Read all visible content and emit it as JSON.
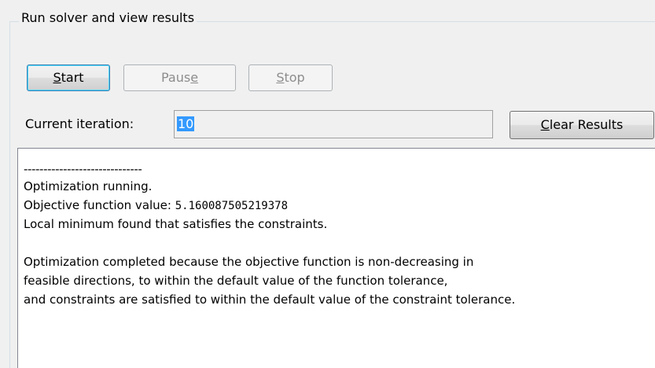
{
  "panel": {
    "title": "Run solver and view results"
  },
  "buttons": {
    "start": {
      "mnemonic": "S",
      "rest": "tart",
      "enabled": true
    },
    "pause": {
      "before": "Pau",
      "mnemonic": "s",
      "mnemonic2": "e",
      "enabled": false
    },
    "stop": {
      "mnemonic": "S",
      "rest": "top",
      "enabled": false
    },
    "clear": {
      "mnemonic": "C",
      "rest": "lear Results",
      "enabled": true
    }
  },
  "iteration": {
    "label": "Current iteration:",
    "value": "10"
  },
  "output": {
    "separator": "------------------------------",
    "lines": [
      "Optimization running.",
      "Objective function value: ",
      "5.160087505219378",
      "Local minimum found that satisfies the constraints.",
      "",
      "Optimization completed because the objective function is non-decreasing in",
      "feasible directions, to within the default value of the function tolerance,",
      "and constraints are satisfied to within the default value of the constraint tolerance."
    ]
  },
  "colors": {
    "selection": "#3399ff",
    "default_button_border": "#3c7fb1",
    "disabled_text": "#8d8d8d"
  }
}
